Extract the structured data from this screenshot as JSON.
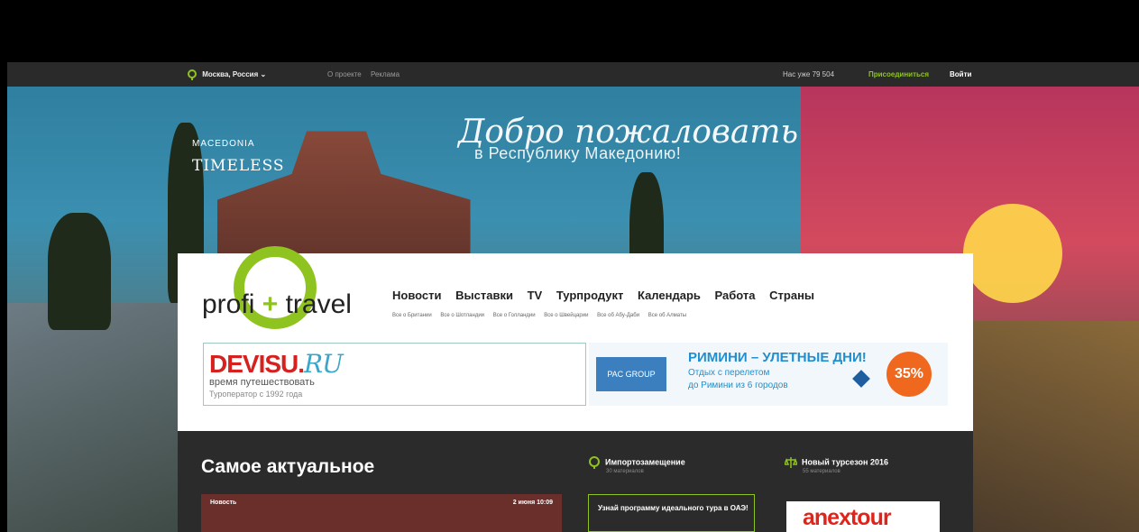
{
  "topbar": {
    "location": "Москва, Россия",
    "links": [
      "О проекте",
      "Реклама"
    ],
    "count": "Нас уже 79 504",
    "join": "Присоединиться",
    "login": "Войти"
  },
  "hero": {
    "welcome_line1": "Добро пожаловать",
    "welcome_line2": "в Республику Македонию!",
    "tag_line1": "MACEDONIA",
    "tag_line2": "TIMELESS"
  },
  "logo": {
    "left": "profi",
    "plus": "+",
    "right": "travel"
  },
  "nav": {
    "items": [
      "Новости",
      "Выставки",
      "TV",
      "Турпродукт",
      "Календарь",
      "Работа",
      "Страны"
    ],
    "sub": [
      "Все о Британии",
      "Все о Шотландии",
      "Все о Голландии",
      "Все о Швейцарии",
      "Все об Абу-Даби",
      "Все об Алматы"
    ]
  },
  "ad_devisu": {
    "brand": "DEVISU.",
    "brand_suffix": "RU",
    "line1": "время путешествовать",
    "line2": "Туроператор с 1992 года"
  },
  "ad_rimini": {
    "pac": "PAC GROUP",
    "head": "РИМИНИ – УЛЕТНЫЕ ДНИ!",
    "sub1": "Отдых с перелетом",
    "sub2": "до Римини из 6 городов",
    "badge": "35%"
  },
  "main": {
    "heading": "Самое актуальное",
    "news_label": "Новость",
    "news_date": "2 июня 10:09",
    "col2_title": "Импортозамещение",
    "col2_meta": "30 материалов",
    "col3_title": "Новый турсезон 2016",
    "col3_meta": "55 материалов",
    "promo_text": "Узнай программу идеального тура в ОАЭ!",
    "anex": "anextour"
  }
}
